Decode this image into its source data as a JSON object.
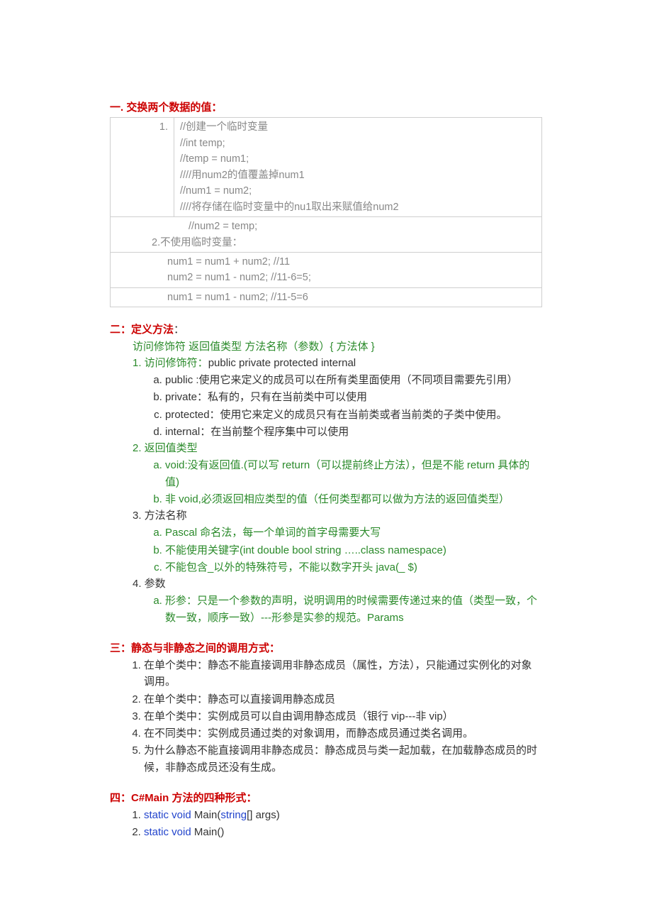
{
  "s1": {
    "heading": "一. 交换两个数据的值：",
    "row1_left": "1.",
    "row1_c1": "//创建一个临时变量",
    "row1_c2": "//int temp;",
    "row1_c3": "//temp = num1;",
    "row1_c4": "////用num2的值覆盖掉num1",
    "row1_c5": "//num1 = num2;",
    "row1_c6": "////将存储在临时变量中的nu1取出来赋值给num2",
    "row2_a": "//num2 = temp;",
    "row2_b": "2.不使用临时变量：",
    "row3_a": "num1 = num1 + num2;   //11",
    "row3_b": "num2 = num1 - num2;   //11-6=5;",
    "row4": "num1 = num1 - num2;   //11-5=6"
  },
  "s2": {
    "heading_cn": "二：定义方法",
    "heading_colon": "：",
    "line1": "访问修饰符    返回值类型    方法名称（参数）{ 方法体 }",
    "item1_a": "1.   访问修饰符：",
    "item1_b": "public    private protected internal",
    "a1_a": "public :",
    "a1_b": "使用它来定义的成员可以在所有类里面使用（不同项目需要先引用）",
    "a2": "private：私有的，只有在当前类中可以使用",
    "a3": "protected：使用它来定义的成员只有在当前类或者当前类的子类中使用。",
    "a4": "internal：在当前整个程序集中可以使用",
    "item2": "2.   返回值类型",
    "b1": "void:没有返回值.(可以写 return（可以提前终止方法），但是不能 return 具体的值)",
    "b2": "非 void,必须返回相应类型的值（任何类型都可以做为方法的返回值类型）",
    "item3": "3.   方法名称",
    "c1": "Pascal 命名法，每一个单词的首字母需要大写",
    "c2": "不能使用关键字(int double bool string …..class namespace)",
    "c3": "不能包含_以外的特殊符号，不能以数字开头     java(_ $)",
    "item4": "4.   参数",
    "d1": "形参：只是一个参数的声明，说明调用的时候需要传递过来的值（类型一致，个数一致，顺序一致）---形参是实参的规范。Params"
  },
  "s3": {
    "heading": "三：静态与非静态之间的调用方式：",
    "i1": "在单个类中：静态不能直接调用非静态成员（属性，方法），只能通过实例化的对象调用。",
    "i2": "在单个类中：静态可以直接调用静态成员",
    "i3": "在单个类中：实例成员可以自由调用静态成员（银行  vip---非 vip）",
    "i4": "在不同类中：实例成员通过类的对象调用，而静态成员通过类名调用。",
    "i5": "为什么静态不能直接调用非静态成员：静态成员与类一起加载，在加载静态成员的时候，非静态成员还没有生成。"
  },
  "s4": {
    "heading": "四：C#Main 方法的四种形式：",
    "l1a": "static void",
    "l1b": " Main(",
    "l1c": "string",
    "l1d": "[] args)",
    "l2a": "static void",
    "l2b": " Main()"
  }
}
